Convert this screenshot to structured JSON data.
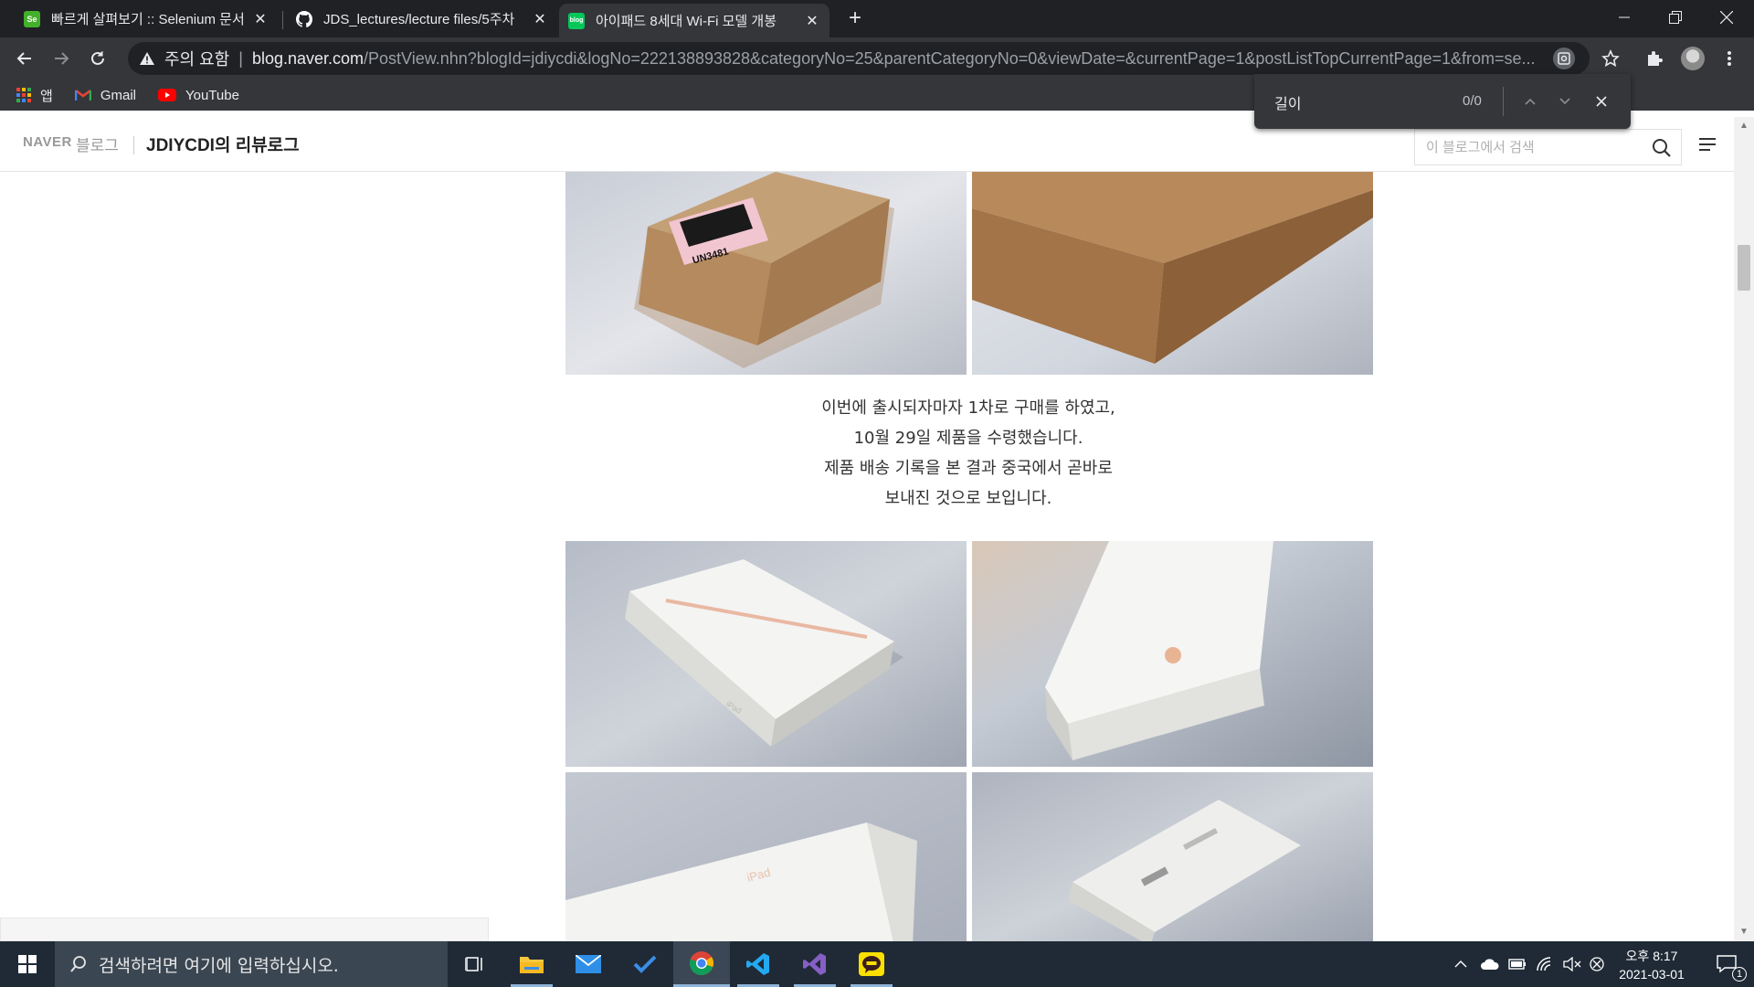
{
  "browser": {
    "tabs": [
      {
        "title": "빠르게 살펴보기 :: Selenium 문서",
        "favicon_text": "Se",
        "favicon_color": "#43b02a"
      },
      {
        "title": "JDS_lectures/lecture files/5주차",
        "favicon_text": "",
        "favicon_color": "#ffffff"
      },
      {
        "title": "아이패드 8세대 Wi-Fi 모델 개봉",
        "favicon_text": "blog",
        "favicon_color": "#03c75a"
      }
    ],
    "address": {
      "security_label": "주의 요함",
      "separator": "|",
      "host": "blog.naver.com",
      "path": "/PostView.nhn?blogId=jdiycdi&logNo=222138893828&categoryNo=25&parentCategoryNo=0&viewDate=&currentPage=1&postListTopCurrentPage=1&from=se..."
    },
    "bookmarks": [
      {
        "label": "앱",
        "icon": "apps-grid-icon"
      },
      {
        "label": "Gmail",
        "icon": "gmail-icon"
      },
      {
        "label": "YouTube",
        "icon": "youtube-icon"
      }
    ]
  },
  "find_bar": {
    "query": "길이",
    "count": "0/0"
  },
  "blog": {
    "naver_label": "NAVER",
    "blog_label": "블로그",
    "title": "JDIYCDI의 리뷰로그",
    "search_placeholder": "이 블로그에서 검색"
  },
  "post": {
    "caption_lines": [
      "이번에 출시되자마자 1차로 구매를 하였고,",
      "10월 29일 제품을 수령했습니다.",
      "제품 배송 기록을 본 결과 중국에서 곧바로",
      "보내진 것으로 보입니다."
    ],
    "sticker_text": "UN3481",
    "ipad_box_text": "iPad"
  },
  "taskbar": {
    "search_placeholder": "검색하려면 여기에 입력하십시오.",
    "clock_time": "오후 8:17",
    "clock_date": "2021-03-01",
    "notification_count": "1",
    "apps": [
      "task-view",
      "file-explorer",
      "mail",
      "todo",
      "chrome",
      "vscode",
      "visual-studio",
      "kakaotalk"
    ]
  },
  "colors": {
    "chrome_dark": "#202124",
    "chrome_toolbar": "#35363a",
    "taskbar": "#1f2a36"
  }
}
